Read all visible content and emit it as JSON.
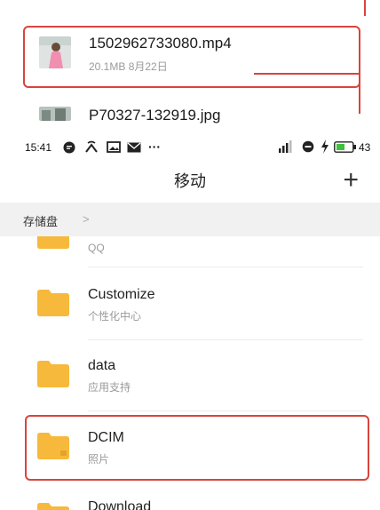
{
  "top_overlay": {
    "file1": {
      "name": "1502962733080.mp4",
      "meta": "20.1MB  8月22日"
    },
    "file2": {
      "name": "P70327-132919.jpg"
    }
  },
  "status_bar": {
    "time": "15:41",
    "dots": "···",
    "battery": "43"
  },
  "header": {
    "title": "移动",
    "add_label": "+"
  },
  "breadcrumb": {
    "root": "存储盘",
    "chevron": ">"
  },
  "folders": [
    {
      "title": "",
      "subtitle": "QQ"
    },
    {
      "title": "Customize",
      "subtitle": "个性化中心"
    },
    {
      "title": "data",
      "subtitle": "应用支持"
    },
    {
      "title": "DCIM",
      "subtitle": "照片"
    },
    {
      "title": "Download",
      "subtitle": ""
    }
  ],
  "colors": {
    "accent_red": "#d9443c",
    "folder": "#f6b93b",
    "folder_dark": "#e4a22a"
  }
}
